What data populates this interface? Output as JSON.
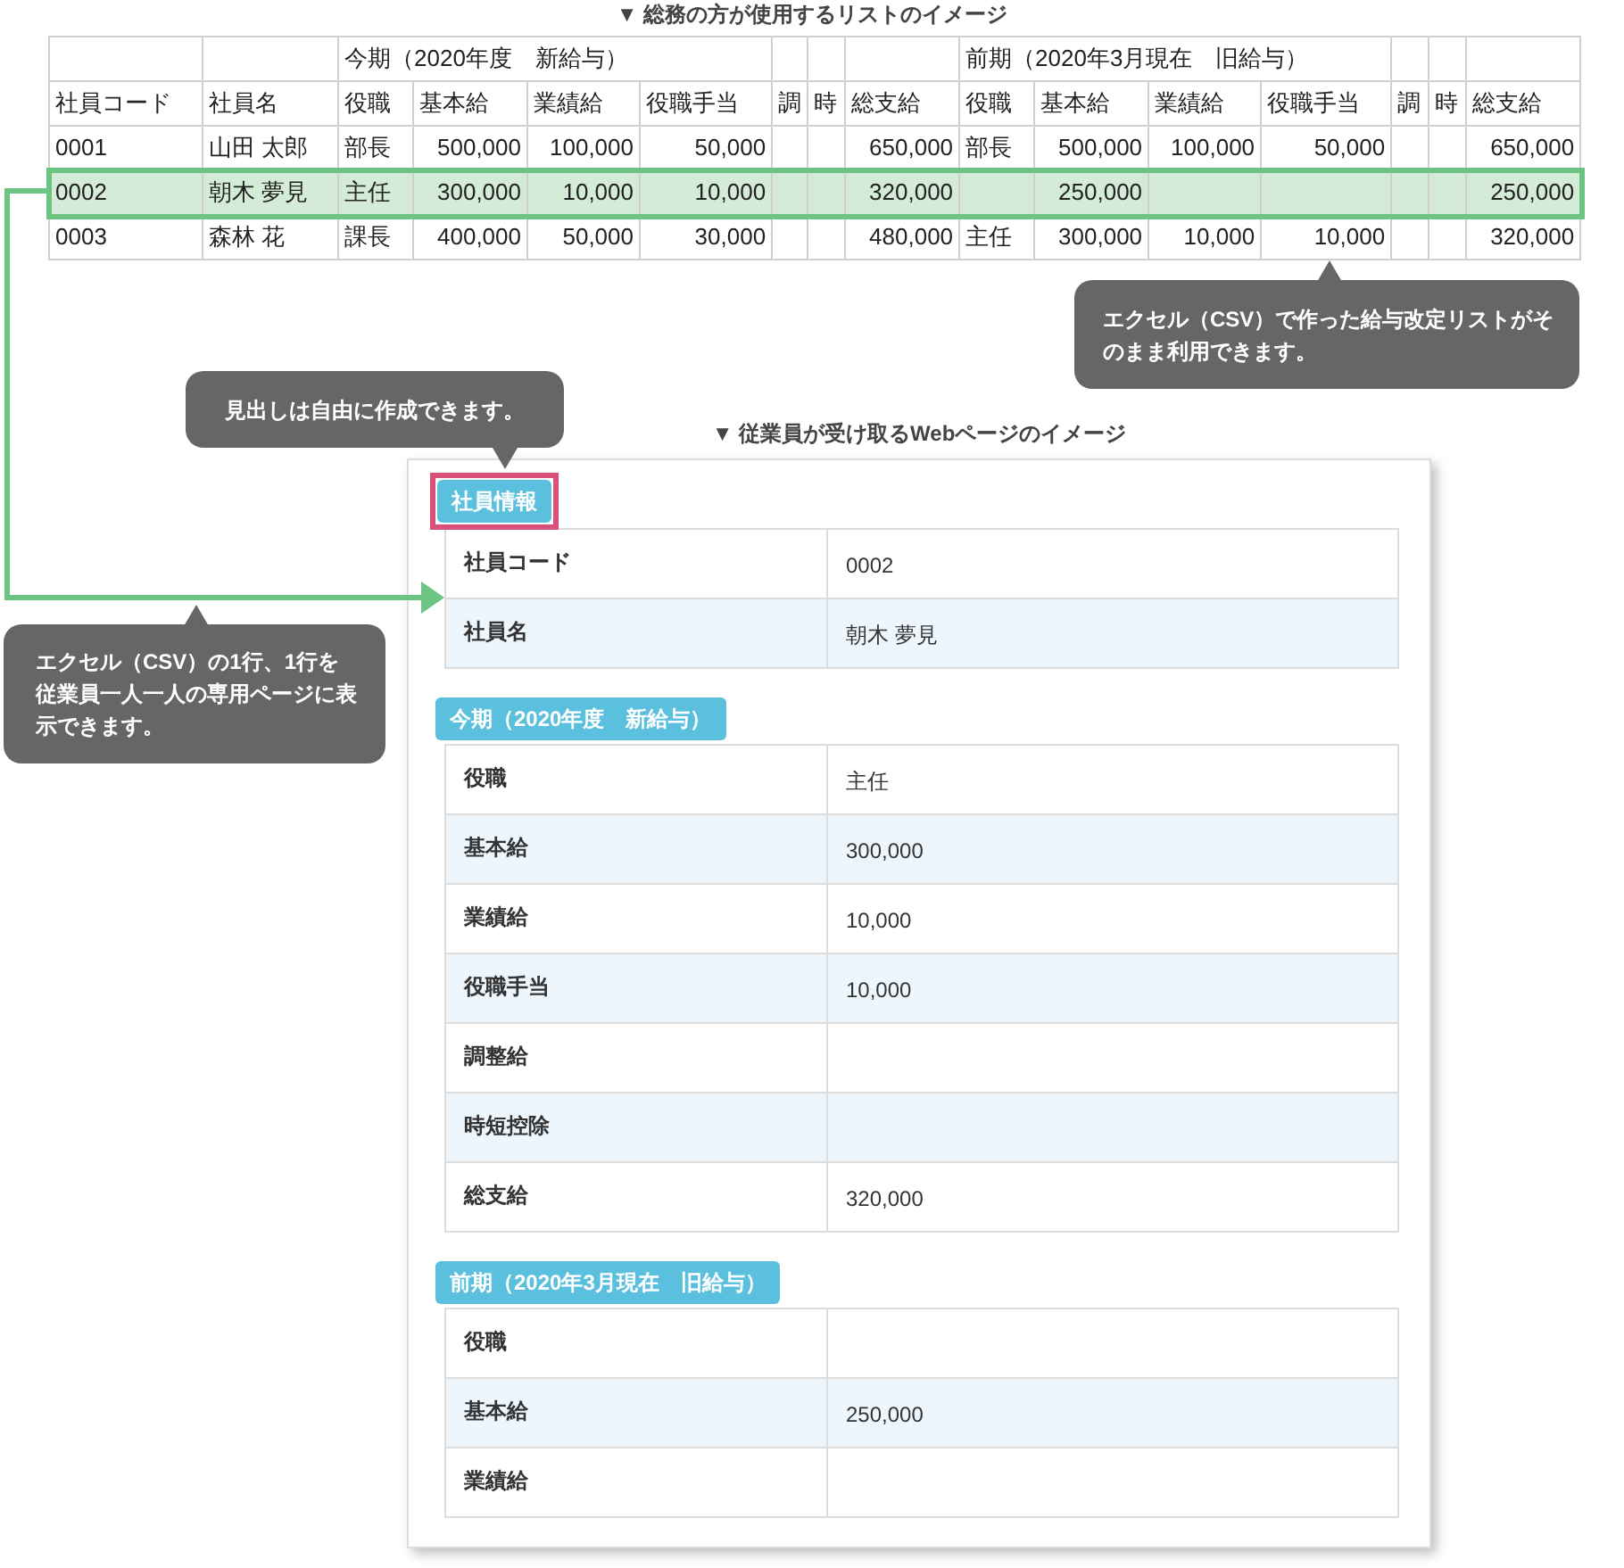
{
  "sheet_title": "▼ 総務の方が使用するリストのイメージ",
  "sheet": {
    "leading_columns": [
      {
        "label": "社員コード",
        "kind": "text"
      },
      {
        "label": "社員名",
        "kind": "text"
      }
    ],
    "groups": [
      {
        "label": "今期（2020年度　新給与）",
        "columns": [
          {
            "label": "役職",
            "kind": "text"
          },
          {
            "label": "基本給",
            "kind": "amount"
          },
          {
            "label": "業績給",
            "kind": "amount"
          },
          {
            "label": "役職手当",
            "kind": "amount"
          }
        ],
        "extra_columns": [
          {
            "label": "調",
            "kind": "amount"
          },
          {
            "label": "時",
            "kind": "amount"
          },
          {
            "label": "総支給",
            "kind": "amount"
          }
        ]
      },
      {
        "label": "前期（2020年3月現在　旧給与）",
        "columns": [
          {
            "label": "役職",
            "kind": "text"
          },
          {
            "label": "基本給",
            "kind": "amount"
          },
          {
            "label": "業績給",
            "kind": "amount"
          },
          {
            "label": "役職手当",
            "kind": "amount"
          }
        ],
        "extra_columns": [
          {
            "label": "調",
            "kind": "amount"
          },
          {
            "label": "時",
            "kind": "amount"
          },
          {
            "label": "総支給",
            "kind": "amount"
          }
        ]
      }
    ],
    "rows": [
      {
        "selected": false,
        "cells": [
          "0001",
          "山田 太郎",
          "部長",
          "500,000",
          "100,000",
          "50,000",
          null,
          null,
          "650,000",
          "部長",
          "500,000",
          "100,000",
          "50,000",
          null,
          null,
          "650,000"
        ]
      },
      {
        "selected": true,
        "cells": [
          "0002",
          "朝木 夢見",
          "主任",
          "300,000",
          "10,000",
          "10,000",
          null,
          null,
          "320,000",
          null,
          "250,000",
          null,
          null,
          null,
          null,
          "250,000"
        ]
      },
      {
        "selected": false,
        "cells": [
          "0003",
          "森林 花",
          "課長",
          "400,000",
          "50,000",
          "30,000",
          null,
          null,
          "480,000",
          "主任",
          "300,000",
          "10,000",
          "10,000",
          null,
          null,
          "320,000"
        ]
      }
    ]
  },
  "callouts": [
    {
      "text": "エクセル（CSV）で作った給与改定リストがそのまま利用できます。"
    },
    {
      "text": "見出しは自由に作成できます。"
    },
    {
      "text": "エクセル（CSV）の1行、1行を従業員一人一人の専用ページに表示できます。"
    }
  ],
  "web_title": "▼ 従業員が受け取るWebページのイメージ",
  "sections": [
    {
      "heading": "社員情報",
      "highlighted": true,
      "rows": [
        {
          "label": "社員コード",
          "value": "0002"
        },
        {
          "label": "社員名",
          "value": "朝木 夢見"
        }
      ]
    },
    {
      "heading": "今期（2020年度　新給与）",
      "highlighted": false,
      "rows": [
        {
          "label": "役職",
          "value": "主任"
        },
        {
          "label": "基本給",
          "value": "300,000"
        },
        {
          "label": "業績給",
          "value": "10,000"
        },
        {
          "label": "役職手当",
          "value": "10,000"
        },
        {
          "label": "調整給"
        },
        {
          "label": "時短控除"
        },
        {
          "label": "総支給",
          "value": "320,000"
        }
      ]
    },
    {
      "heading": "前期（2020年3月現在　旧給与）",
      "highlighted": false,
      "rows": [
        {
          "label": "役職"
        },
        {
          "label": "基本給",
          "value": "250,000"
        },
        {
          "label": "業績給"
        }
      ]
    }
  ]
}
